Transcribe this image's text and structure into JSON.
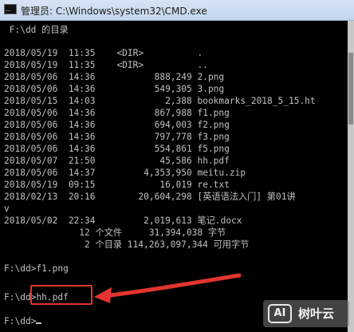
{
  "window": {
    "title": "管理员: C:\\Windows\\system32\\CMD.exe"
  },
  "console": {
    "lines": [
      " F:\\dd 的目录",
      "",
      "2018/05/19  11:35    <DIR>          .",
      "2018/05/19  11:35    <DIR>          ..",
      "2018/05/06  14:36           888,249 2.png",
      "2018/05/06  14:36           549,305 3.png",
      "2018/05/15  14:03             2,388 bookmarks_2018_5_15.ht",
      "2018/05/06  14:36           867,988 f1.png",
      "2018/05/06  14:36           694,003 f2.png",
      "2018/05/06  14:36           797,778 f3.png",
      "2018/05/06  14:36           554,861 f5.png",
      "2018/05/07  21:50            45,586 hh.pdf",
      "2018/05/06  14:37         4,353,950 meitu.zip",
      "2018/05/19  09:15            16,019 re.txt",
      "2018/02/13  20:16        20,604,298 [英语语法入门] 第01讲",
      "v",
      "2018/05/02  22:34         2,019,613 笔记.docx",
      "              12 个文件     31,394,038 字节",
      "               2 个目录 114,263,097,344 可用字节",
      "",
      "F:\\dd>f1.png",
      "",
      "F:\\dd>hh.pdf",
      "",
      "F:\\dd>"
    ]
  },
  "icons": {
    "title_icon": "cmd-icon",
    "arrow": "arrow-icon"
  },
  "colors": {
    "console_bg": "#000000",
    "console_text": "#c0c0c0",
    "annotation_red": "#e3342f"
  },
  "watermark": {
    "badge": "AI",
    "text": "树叶云"
  }
}
